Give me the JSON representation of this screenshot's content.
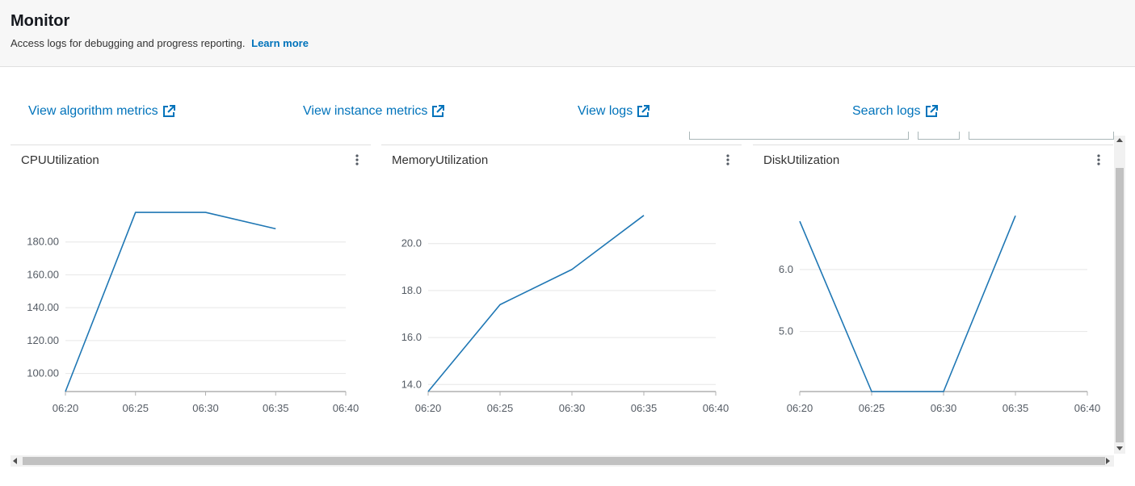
{
  "header": {
    "title": "Monitor",
    "description": "Access logs for debugging and progress reporting.",
    "learn_more": "Learn more"
  },
  "links": [
    {
      "label": "View algorithm metrics",
      "icon": "external-link-icon"
    },
    {
      "label": "View instance metrics",
      "icon": "external-link-icon"
    },
    {
      "label": "View logs",
      "icon": "external-link-icon"
    },
    {
      "label": "Search logs",
      "icon": "external-link-icon"
    }
  ],
  "colors": {
    "link": "#0073bb",
    "series": "#1f77b4",
    "grid": "#e6e6e6",
    "axis": "#b0b0b0"
  },
  "chart_data": [
    {
      "type": "line",
      "title": "CPUUtilization",
      "x": [
        "06:20",
        "06:25",
        "06:30",
        "06:35"
      ],
      "xticks": [
        "06:20",
        "06:25",
        "06:30",
        "06:35",
        "06:40"
      ],
      "values": [
        89,
        198,
        198,
        188
      ],
      "yticks": [
        100,
        120,
        140,
        160,
        180
      ],
      "ytick_labels": [
        "100.00",
        "120.00",
        "140.00",
        "160.00",
        "180.00"
      ],
      "ylim": [
        89,
        199
      ],
      "grid": true
    },
    {
      "type": "line",
      "title": "MemoryUtilization",
      "x": [
        "06:20",
        "06:25",
        "06:30",
        "06:35"
      ],
      "xticks": [
        "06:20",
        "06:25",
        "06:30",
        "06:35",
        "06:40"
      ],
      "values": [
        13.7,
        17.4,
        18.9,
        21.2
      ],
      "yticks": [
        14,
        16,
        18,
        20
      ],
      "ytick_labels": [
        "14.0",
        "16.0",
        "18.0",
        "20.0"
      ],
      "ylim": [
        13.7,
        21.4
      ],
      "grid": true
    },
    {
      "type": "line",
      "title": "DiskUtilization",
      "x": [
        "06:20",
        "06:25",
        "06:30",
        "06:35"
      ],
      "xticks": [
        "06:20",
        "06:25",
        "06:30",
        "06:35",
        "06:40"
      ],
      "values": [
        6.78,
        4.03,
        4.03,
        6.87
      ],
      "yticks": [
        5,
        6
      ],
      "ytick_labels": [
        "5.0",
        "6.0"
      ],
      "ylim": [
        4.03,
        6.95
      ],
      "grid": true
    }
  ]
}
